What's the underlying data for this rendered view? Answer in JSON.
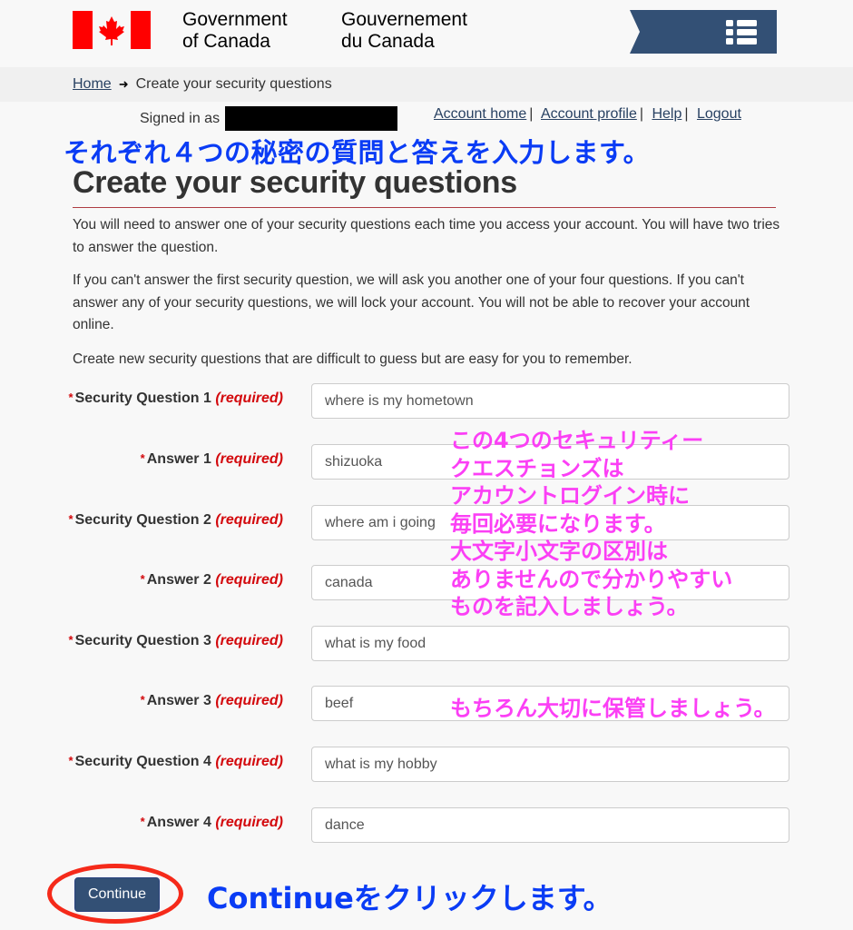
{
  "header": {
    "signature_en": [
      "Government",
      "of Canada"
    ],
    "signature_fr": [
      "Gouvernement",
      "du Canada"
    ],
    "menu_icon": "list-menu-icon",
    "flag_color": "#ff0000",
    "menu_color": "#335075"
  },
  "breadcrumb": {
    "home": "Home",
    "arrow": "➜",
    "current": "Create your security questions"
  },
  "account_bar": {
    "signed_in_label": "Signed in as",
    "links": [
      "Account home",
      "Account profile",
      "Help",
      "Logout"
    ],
    "separator": "|"
  },
  "annotations": {
    "top_blue": "それぞれ４つの秘密の質問と答えを入力します。",
    "pink_lines": [
      "この4つのセキュリティー",
      "クエスチョンズは",
      "アカウントログイン時に",
      "毎回必要になります。",
      "大文字小文字の区別は",
      "ありませんので分かりやすい",
      "ものを記入しましょう。"
    ],
    "pink_bottom": "もちろん大切に保管しましょう。",
    "bottom_blue": "Continueをクリックします。",
    "blue_color": "#0a3cf5",
    "pink_color": "#fb3ff5",
    "ellipse_color": "#f52a1a"
  },
  "main": {
    "title": "Create your security questions",
    "paragraphs": [
      "You will need to answer one of your security questions each time you access your account. You will have two tries to answer the question.",
      "If you can't answer the first security question, we will ask you another one of your four questions. If you can't answer any of your security questions, we will lock your account.  You will not be able to recover your account online.",
      "Create new security questions that are difficult to guess but are easy for you to remember."
    ],
    "required_marker": "*",
    "required_text": "(required)",
    "fields": [
      {
        "label": "Security Question 1",
        "value": "where is my hometown"
      },
      {
        "label": "Answer 1",
        "value": "shizuoka"
      },
      {
        "label": "Security Question 2",
        "value": "where am i going"
      },
      {
        "label": "Answer 2",
        "value": "canada"
      },
      {
        "label": "Security Question 3",
        "value": "what is my food"
      },
      {
        "label": "Answer 3",
        "value": "beef"
      },
      {
        "label": "Security Question 4",
        "value": "what is my hobby"
      },
      {
        "label": "Answer 4",
        "value": "dance"
      }
    ],
    "continue_label": "Continue"
  }
}
